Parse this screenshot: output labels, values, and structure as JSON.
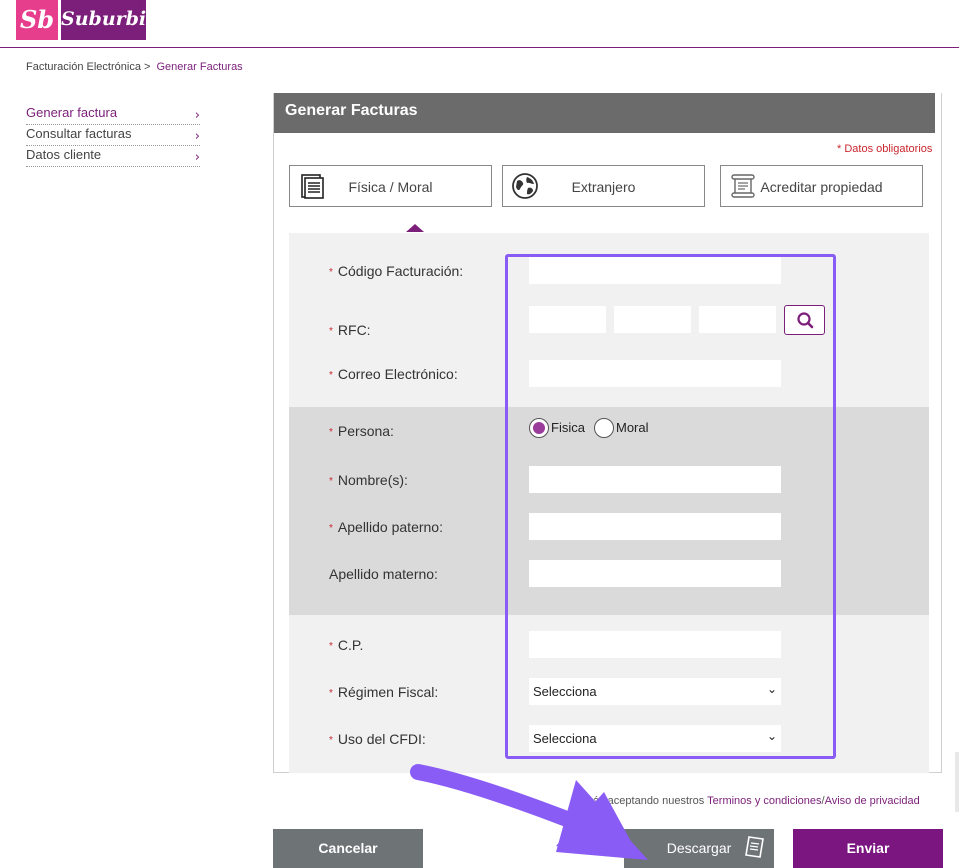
{
  "brand": {
    "logo_mark": "Sb",
    "logo_word": "Suburbia",
    "reg": "®"
  },
  "breadcrumb": {
    "root": "Facturación Electrónica >",
    "current": "Generar Facturas"
  },
  "sidebar": {
    "items": [
      {
        "label": "Generar factura",
        "active": true
      },
      {
        "label": "Consultar facturas",
        "active": false
      },
      {
        "label": "Datos cliente",
        "active": false
      }
    ],
    "chevron": "›"
  },
  "panel": {
    "title": "Generar Facturas",
    "required_note": "* Datos obligatorios"
  },
  "tabs": [
    {
      "label": "Física / Moral",
      "icon": "document-icon",
      "selected": true
    },
    {
      "label": "Extranjero",
      "icon": "globe-icon",
      "selected": false
    },
    {
      "label": "Acreditar propiedad",
      "icon": "scroll-icon",
      "selected": false
    }
  ],
  "form": {
    "required_mark": "*",
    "codigo": {
      "label": "Código Facturación:",
      "value": ""
    },
    "rfc": {
      "label": "RFC:",
      "part1": "",
      "part2": "",
      "part3": ""
    },
    "correo": {
      "label": "Correo Electrónico:",
      "value": ""
    },
    "persona": {
      "label": "Persona:",
      "options": [
        "Fisica",
        "Moral"
      ],
      "selected": "Fisica"
    },
    "nombre": {
      "label": "Nombre(s):",
      "value": ""
    },
    "apellido_paterno": {
      "label": "Apellido paterno:",
      "value": ""
    },
    "apellido_materno": {
      "label": "Apellido materno:",
      "value": ""
    },
    "cp": {
      "label": "C.P.",
      "value": ""
    },
    "regimen": {
      "label": "Régimen Fiscal:",
      "selected": "Selecciona"
    },
    "uso_cfdi": {
      "label": "Uso del CFDI:",
      "selected": "Selecciona"
    }
  },
  "terms": {
    "prefix": "ás aceptando nuestros",
    "link1": "Terminos y condiciones",
    "separator": "/",
    "link2": "Aviso de privacidad"
  },
  "buttons": {
    "cancel": "Cancelar",
    "download": "Descargar",
    "send": "Enviar"
  },
  "colors": {
    "brand_purple": "#7b1f7a",
    "brand_pink": "#e63d8c",
    "highlight": "#8a5cf6",
    "required_red": "#c9262d"
  }
}
